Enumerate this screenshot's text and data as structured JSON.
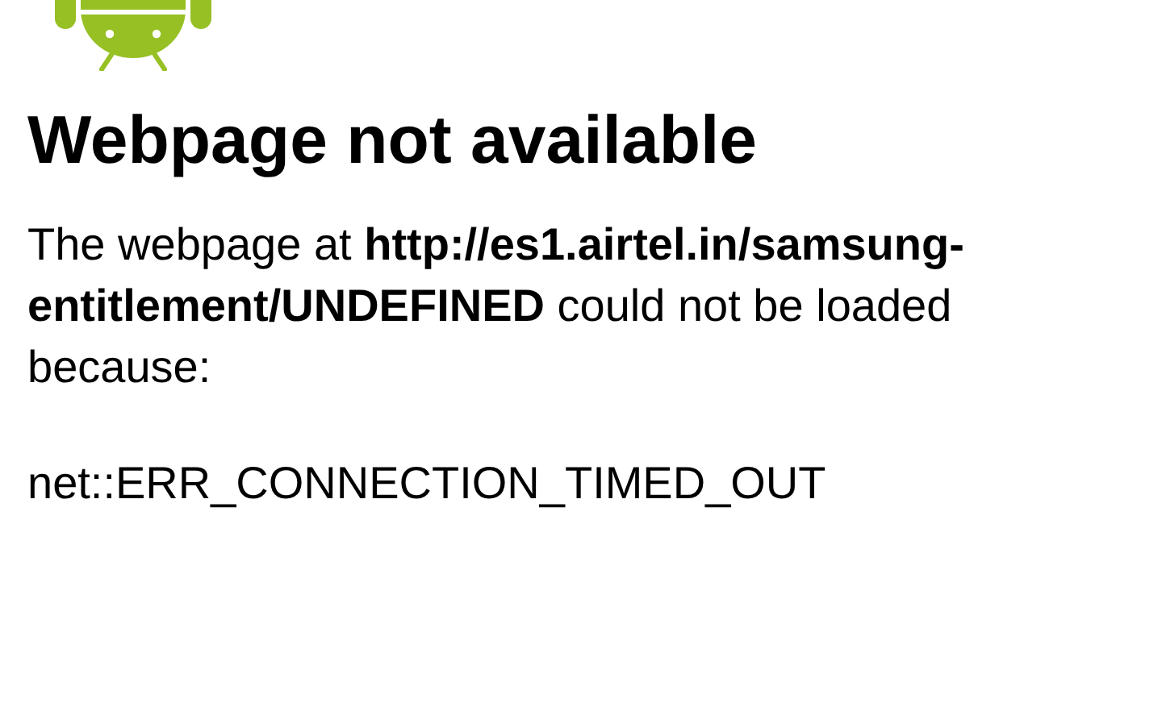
{
  "title": "Webpage not available",
  "message": "The webpage at **http://es1.airtel.in/samsung-entitlement/UNDEFINED** could not be loaded because:",
  "error_code": "net::ERR_CONNECTION_TIMED_OUT"
}
